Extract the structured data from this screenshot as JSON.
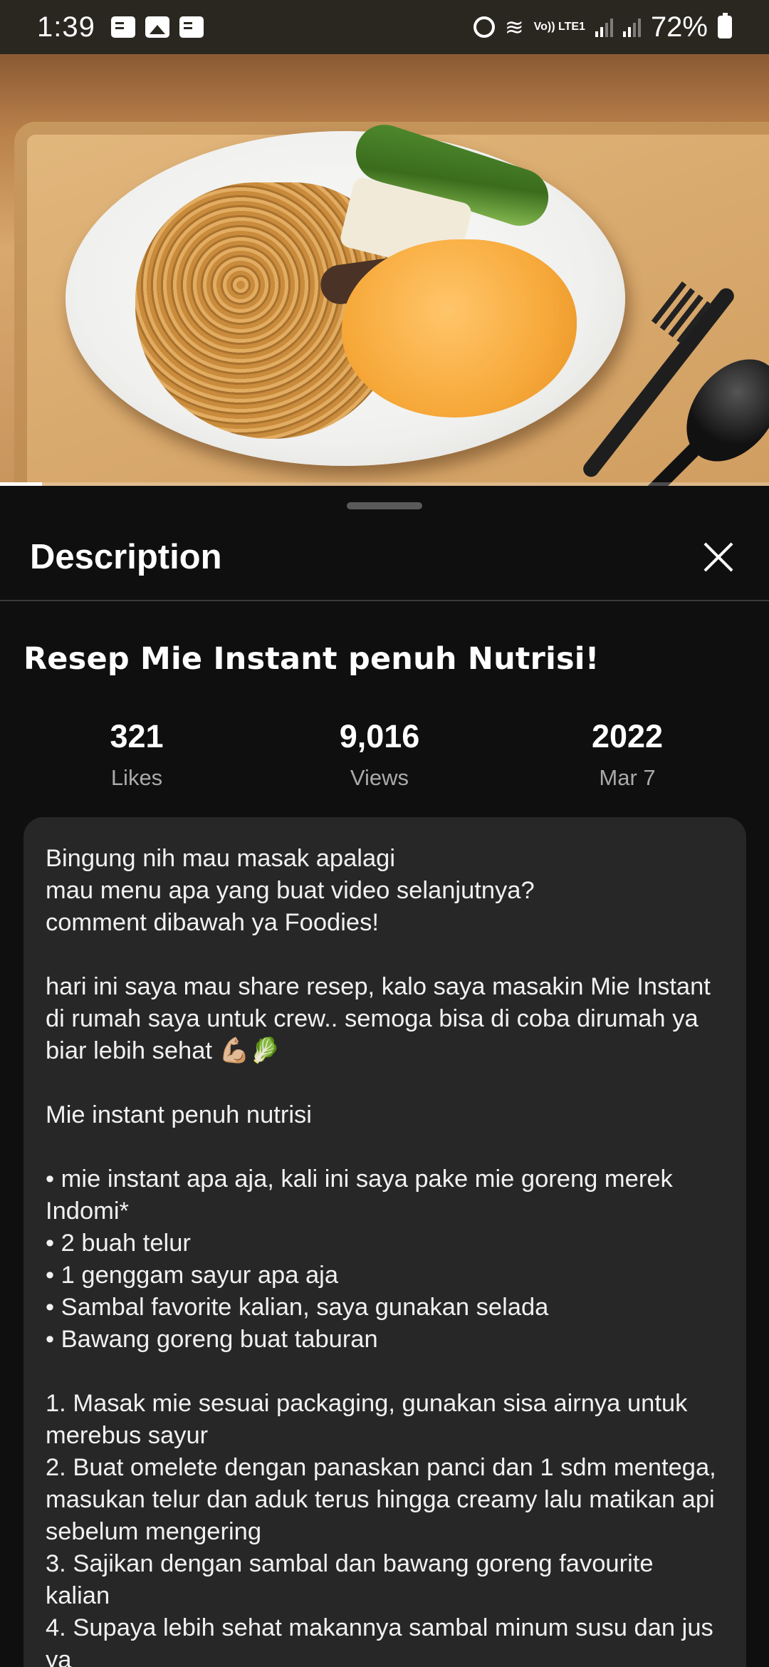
{
  "status_bar": {
    "time": "1:39",
    "battery": "72%",
    "volte_label": "Vo)) LTE1"
  },
  "video": {
    "progress_fraction": 0.055
  },
  "panel": {
    "title": "Description"
  },
  "video_info": {
    "title": "Resep Mie Instant penuh Nutrisi!",
    "stats": [
      {
        "value": "321",
        "label": "Likes"
      },
      {
        "value": "9,016",
        "label": "Views"
      },
      {
        "value": "2022",
        "label": "Mar 7"
      }
    ]
  },
  "description": {
    "text": "Bingung nih mau masak apalagi\nmau menu apa yang buat video selanjutnya?\ncomment dibawah ya Foodies!\n\nhari ini saya mau share resep, kalo saya masakin Mie Instant di rumah saya untuk crew.. semoga bisa di coba dirumah ya biar lebih sehat 💪🏼🥬\n\nMie instant penuh nutrisi\n\n• mie instant apa aja, kali ini saya pake mie goreng merek Indomi*\n• 2 buah telur\n• 1 genggam sayur apa aja\n• Sambal favorite kalian, saya gunakan selada\n• Bawang goreng buat taburan\n\n1. Masak mie sesuai packaging, gunakan sisa airnya untuk merebus sayur\n2. Buat omelete dengan panaskan panci dan 1 sdm mentega, masukan telur dan aduk terus hingga creamy lalu matikan api sebelum mengering\n3. Sajikan dengan sambal dan bawang goreng favourite kalian\n4. Supaya lebih sehat makannya sambal minum susu dan jus ya"
  }
}
